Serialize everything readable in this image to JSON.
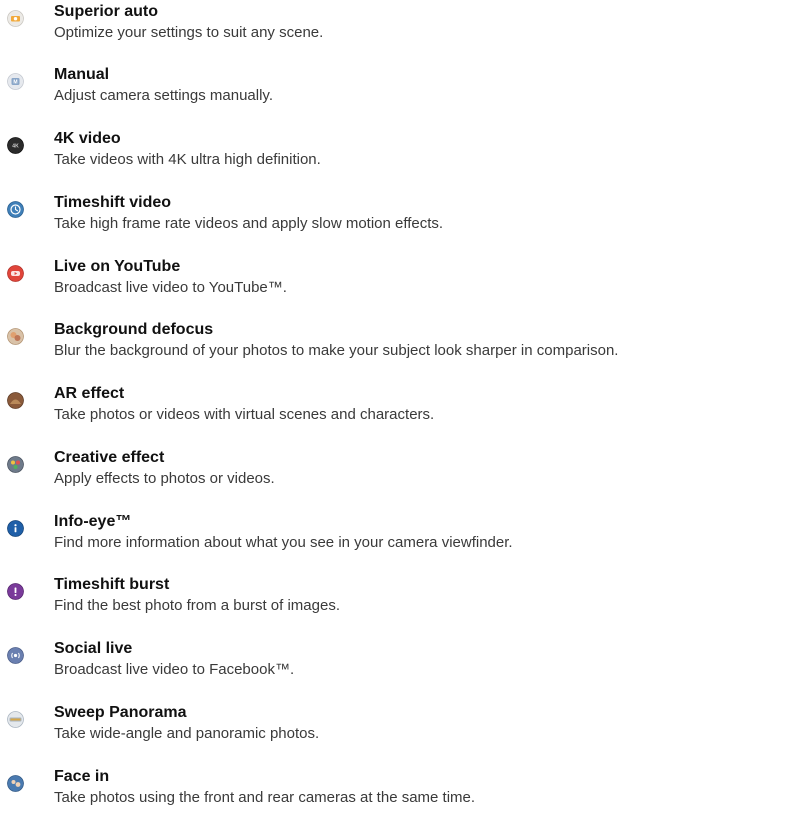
{
  "modes": [
    {
      "title": "Superior auto",
      "description": "Optimize your settings to suit any scene.",
      "icon": "superior-auto-icon",
      "icon_color": "#f2a93b"
    },
    {
      "title": "Manual",
      "description": "Adjust camera settings manually.",
      "icon": "manual-icon",
      "icon_color": "#8aa6c8"
    },
    {
      "title": "4K video",
      "description": "Take videos with 4K ultra high definition.",
      "icon": "4k-video-icon",
      "icon_color": "#2b2b2b"
    },
    {
      "title": "Timeshift video",
      "description": "Take high frame rate videos and apply slow motion effects.",
      "icon": "timeshift-video-icon",
      "icon_color": "#3f7fb8"
    },
    {
      "title": "Live on YouTube",
      "description": "Broadcast live video to YouTube™.",
      "icon": "live-on-youtube-icon",
      "icon_color": "#e0453a"
    },
    {
      "title": "Background defocus",
      "description": "Blur the background of your photos to make your subject look sharper in comparison.",
      "icon": "background-defocus-icon",
      "icon_color": "#e0a070"
    },
    {
      "title": "AR effect",
      "description": "Take photos or videos with virtual scenes and characters.",
      "icon": "ar-effect-icon",
      "icon_color": "#8a5a3a"
    },
    {
      "title": "Creative effect",
      "description": "Apply effects to photos or videos.",
      "icon": "creative-effect-icon",
      "icon_color": "#6e7a8a"
    },
    {
      "title": "Info-eye™",
      "description": "Find more information about what you see in your camera viewfinder.",
      "icon": "info-eye-icon",
      "icon_color": "#1f5fa8"
    },
    {
      "title": "Timeshift burst",
      "description": "Find the best photo from a burst of images.",
      "icon": "timeshift-burst-icon",
      "icon_color": "#7a3a9a"
    },
    {
      "title": "Social live",
      "description": "Broadcast live video to Facebook™.",
      "icon": "social-live-icon",
      "icon_color": "#6a7fb0"
    },
    {
      "title": "Sweep Panorama",
      "description": "Take wide-angle and panoramic photos.",
      "icon": "sweep-panorama-icon",
      "icon_color": "#a9b4c0"
    },
    {
      "title": "Face in",
      "description": "Take photos using the front and rear cameras at the same time.",
      "icon": "face-in-icon",
      "icon_color": "#4a7ab0"
    }
  ]
}
